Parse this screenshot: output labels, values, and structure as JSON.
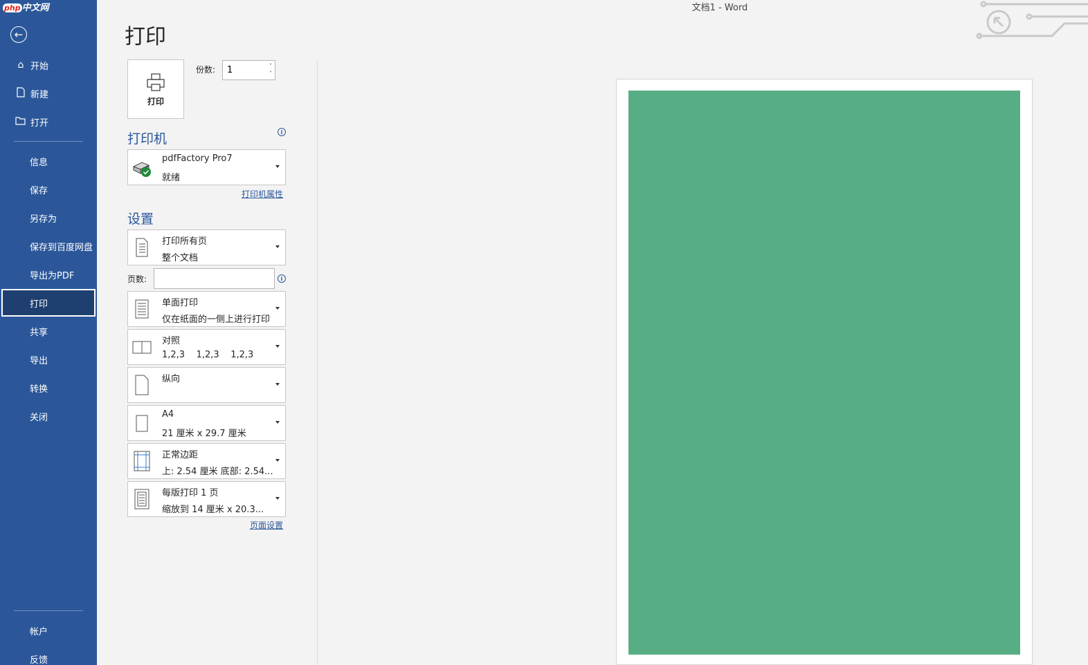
{
  "watermark": {
    "php": "php",
    "site": "中文网"
  },
  "window": {
    "title": "文档1  -  Word"
  },
  "sidebar": {
    "back_icon": "back-arrow-icon",
    "items": [
      {
        "label": "开始",
        "icon": "home-icon"
      },
      {
        "label": "新建",
        "icon": "new-document-icon"
      },
      {
        "label": "打开",
        "icon": "open-folder-icon"
      },
      {
        "label": "信息"
      },
      {
        "label": "保存"
      },
      {
        "label": "另存为"
      },
      {
        "label": "保存到百度网盘"
      },
      {
        "label": "导出为PDF"
      },
      {
        "label": "打印",
        "active": true
      },
      {
        "label": "共享"
      },
      {
        "label": "导出"
      },
      {
        "label": "转换"
      },
      {
        "label": "关闭"
      }
    ],
    "bottom_items": [
      {
        "label": "帐户"
      },
      {
        "label": "反馈"
      }
    ],
    "colors": {
      "background": "#2b579a",
      "active": "#1e3f6f"
    }
  },
  "print": {
    "heading": "打印",
    "button_label": "打印",
    "copies_label": "份数:",
    "copies_value": "1",
    "printer_section": "打印机",
    "printer": {
      "name": "pdfFactory Pro7",
      "status": "就绪",
      "icon": "printer-ready-icon"
    },
    "printer_properties_link": "打印机属性",
    "settings_section": "设置",
    "pages_label": "页数:",
    "pages_value": "",
    "settings": [
      {
        "line1": "打印所有页",
        "line2": "整个文档",
        "icon": "document-pages-icon"
      },
      {
        "line1": "单面打印",
        "line2": "仅在纸面的一侧上进行打印",
        "icon": "one-sided-icon"
      },
      {
        "line1": "对照",
        "line2": "1,2,3    1,2,3    1,2,3",
        "icon": "collate-icon"
      },
      {
        "line1": "纵向",
        "line2": "",
        "icon": "portrait-icon"
      },
      {
        "line1": "A4",
        "line2": "21 厘米 x 29.7 厘米",
        "icon": "paper-size-icon"
      },
      {
        "line1": "正常边距",
        "line2": "上: 2.54 厘米 底部: 2.54...",
        "icon": "margins-icon"
      },
      {
        "line1": "每版打印 1 页",
        "line2": "缩放到 14 厘米 x 20.3...",
        "icon": "pages-per-sheet-icon"
      }
    ],
    "page_setup_link": "页面设置"
  },
  "preview": {
    "fill_color": "#57ae84"
  }
}
